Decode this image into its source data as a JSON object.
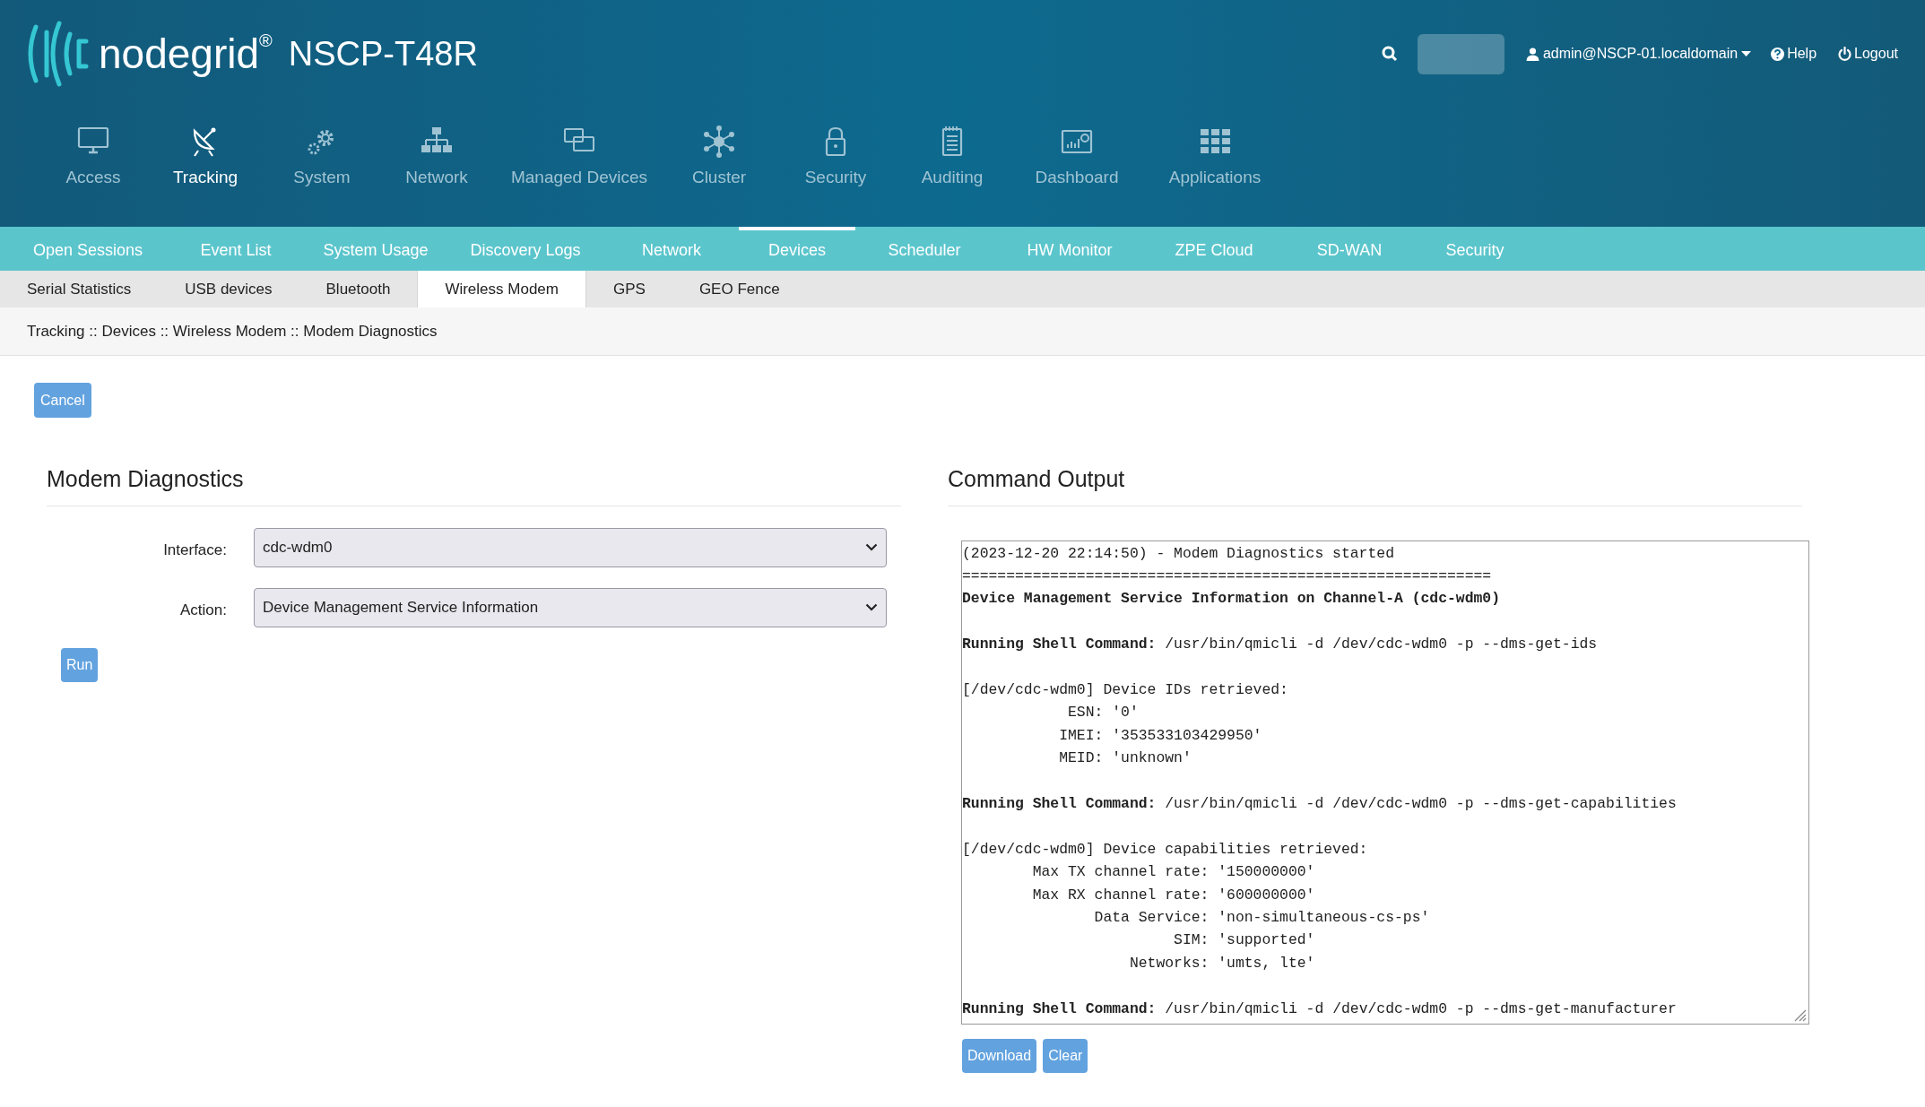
{
  "header": {
    "brand": "nodegrid",
    "registered": "®",
    "model": "NSCP-T48R",
    "user": "admin@NSCP-01.localdomain",
    "help": "Help",
    "logout": "Logout"
  },
  "main_nav": [
    {
      "label": "Access",
      "selected": false
    },
    {
      "label": "Tracking",
      "selected": true
    },
    {
      "label": "System",
      "selected": false
    },
    {
      "label": "Network",
      "selected": false
    },
    {
      "label": "Managed Devices",
      "selected": false
    },
    {
      "label": "Cluster",
      "selected": false
    },
    {
      "label": "Security",
      "selected": false
    },
    {
      "label": "Auditing",
      "selected": false
    },
    {
      "label": "Dashboard",
      "selected": false
    },
    {
      "label": "Applications",
      "selected": false
    }
  ],
  "sub_nav": [
    {
      "label": "Open Sessions",
      "selected": false
    },
    {
      "label": "Event List",
      "selected": false
    },
    {
      "label": "System Usage",
      "selected": false
    },
    {
      "label": "Discovery Logs",
      "selected": false
    },
    {
      "label": "Network",
      "selected": false
    },
    {
      "label": "Devices",
      "selected": true
    },
    {
      "label": "Scheduler",
      "selected": false
    },
    {
      "label": "HW Monitor",
      "selected": false
    },
    {
      "label": "ZPE Cloud",
      "selected": false
    },
    {
      "label": "SD-WAN",
      "selected": false
    },
    {
      "label": "Security",
      "selected": false
    }
  ],
  "tabs": [
    {
      "label": "Serial Statistics",
      "selected": false
    },
    {
      "label": "USB devices",
      "selected": false
    },
    {
      "label": "Bluetooth",
      "selected": false
    },
    {
      "label": "Wireless Modem",
      "selected": true
    },
    {
      "label": "GPS",
      "selected": false
    },
    {
      "label": "GEO Fence",
      "selected": false
    }
  ],
  "breadcrumb": "Tracking :: Devices :: Wireless Modem :: Modem Diagnostics",
  "cancel_button": "Cancel",
  "diagnostics": {
    "title": "Modem Diagnostics",
    "fields": [
      {
        "label": "Interface:",
        "value": "cdc-wdm0"
      },
      {
        "label": "Action:",
        "value": "Device Management Service Information"
      }
    ],
    "run_button": "Run"
  },
  "output": {
    "title": "Command Output",
    "blocks": [
      [
        {
          "kind": "plain",
          "text": "(2023-12-20 22:14:50) - Modem Diagnostics started"
        },
        {
          "kind": "plain",
          "text": "============================================================"
        },
        {
          "kind": "bold",
          "text": "Device Management Service Information on Channel-A (cdc-wdm0)"
        }
      ],
      [
        {
          "kind": "plain",
          "text": "**Running Shell Command:** /usr/bin/qmicli -d /dev/cdc-wdm0 -p --dms-get-ids"
        }
      ],
      [
        {
          "kind": "plain",
          "text": "[/dev/cdc-wdm0] Device IDs retrieved:"
        },
        {
          "kind": "plain",
          "text": "            ESN: '0'"
        },
        {
          "kind": "plain",
          "text": "           IMEI: '353533103429950'"
        },
        {
          "kind": "plain",
          "text": "           MEID: 'unknown'"
        }
      ],
      [
        {
          "kind": "plain",
          "text": "**Running Shell Command:** /usr/bin/qmicli -d /dev/cdc-wdm0 -p --dms-get-capabilities"
        }
      ],
      [
        {
          "kind": "plain",
          "text": "[/dev/cdc-wdm0] Device capabilities retrieved:"
        },
        {
          "kind": "plain",
          "text": "        Max TX channel rate: '150000000'"
        },
        {
          "kind": "plain",
          "text": "        Max RX channel rate: '600000000'"
        },
        {
          "kind": "plain",
          "text": "               Data Service: 'non-simultaneous-cs-ps'"
        },
        {
          "kind": "plain",
          "text": "                        SIM: 'supported'"
        },
        {
          "kind": "plain",
          "text": "                   Networks: 'umts, lte'"
        }
      ],
      [
        {
          "kind": "plain",
          "text": "**Running Shell Command:** /usr/bin/qmicli -d /dev/cdc-wdm0 -p --dms-get-manufacturer"
        }
      ]
    ],
    "buttons": [
      "Download",
      "Clear"
    ]
  }
}
